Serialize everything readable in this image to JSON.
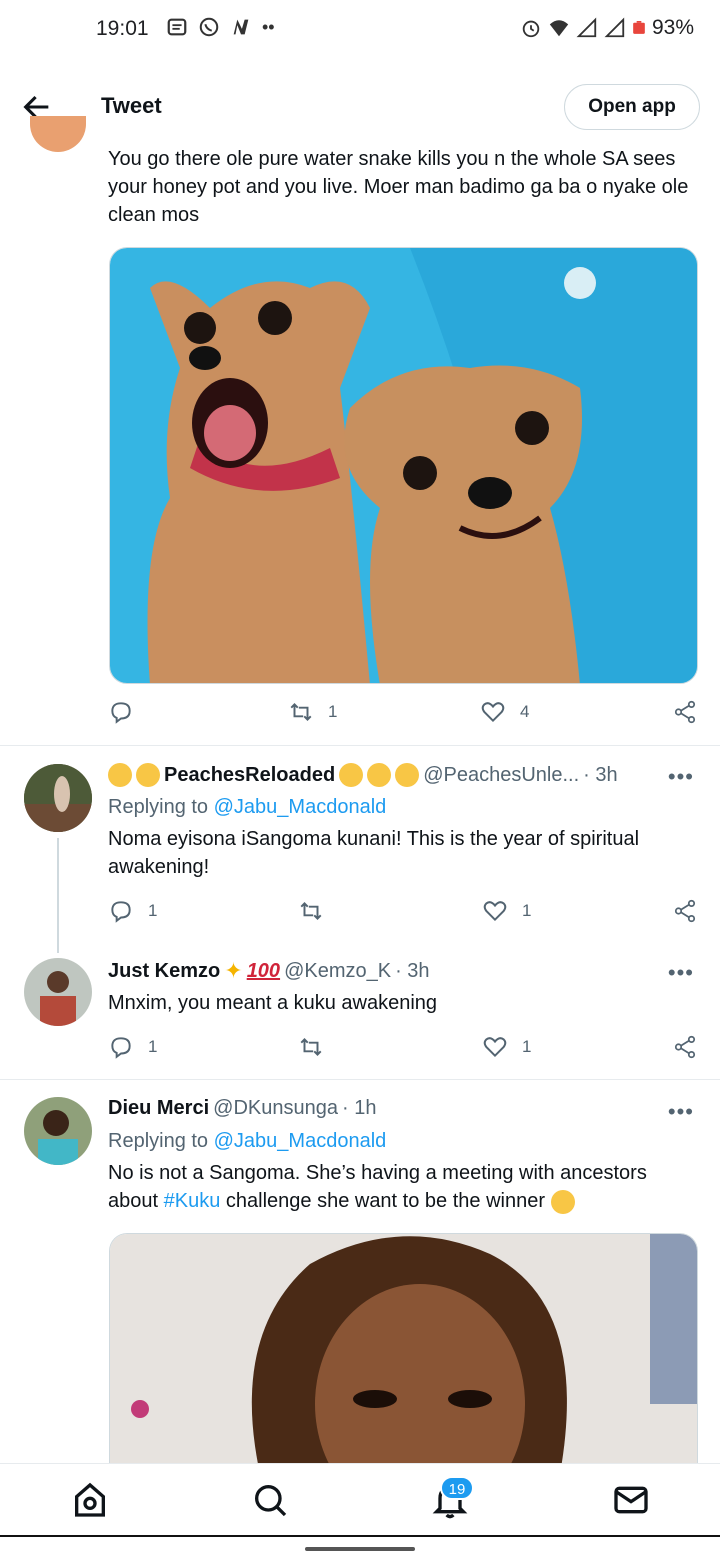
{
  "status_bar": {
    "time": "19:01",
    "battery": "93%"
  },
  "header": {
    "title": "Tweet",
    "open_app": "Open app"
  },
  "main_tweet": {
    "text": "You go there ole pure water snake kills you n the whole SA sees your honey pot and you live. Moer man badimo ga ba o nyake ole clean mos",
    "retweets": "1",
    "likes": "4"
  },
  "replies": [
    {
      "name": "PeachesReloaded",
      "handle": "@PeachesUnle...",
      "time": "· 3h",
      "replying_label": "Replying to",
      "replying_to": "@Jabu_Macdonald",
      "text": "Noma eyisona iSangoma kunani! This is the year of spiritual awakening!",
      "replies": "1",
      "retweets": "",
      "likes": "1"
    },
    {
      "name": "Just Kemzo",
      "handle": "@Kemzo_K",
      "time": "· 3h",
      "text": "Mnxim, you meant a kuku awakening",
      "replies": "1",
      "retweets": "",
      "likes": "1"
    },
    {
      "name": "Dieu Merci",
      "handle": "@DKunsunga",
      "time": "· 1h",
      "replying_label": "Replying to",
      "replying_to": "@Jabu_Macdonald",
      "text_before": "No is not a Sangoma. She’s having a meeting with ancestors about ",
      "hashtag": "#Kuku",
      "text_after": " challenge she want to be the winner"
    }
  ],
  "bottom_nav": {
    "notification_count": "19"
  },
  "colors": {
    "accent": "#1d9bf0",
    "muted": "#536471",
    "text": "#0f1419"
  }
}
